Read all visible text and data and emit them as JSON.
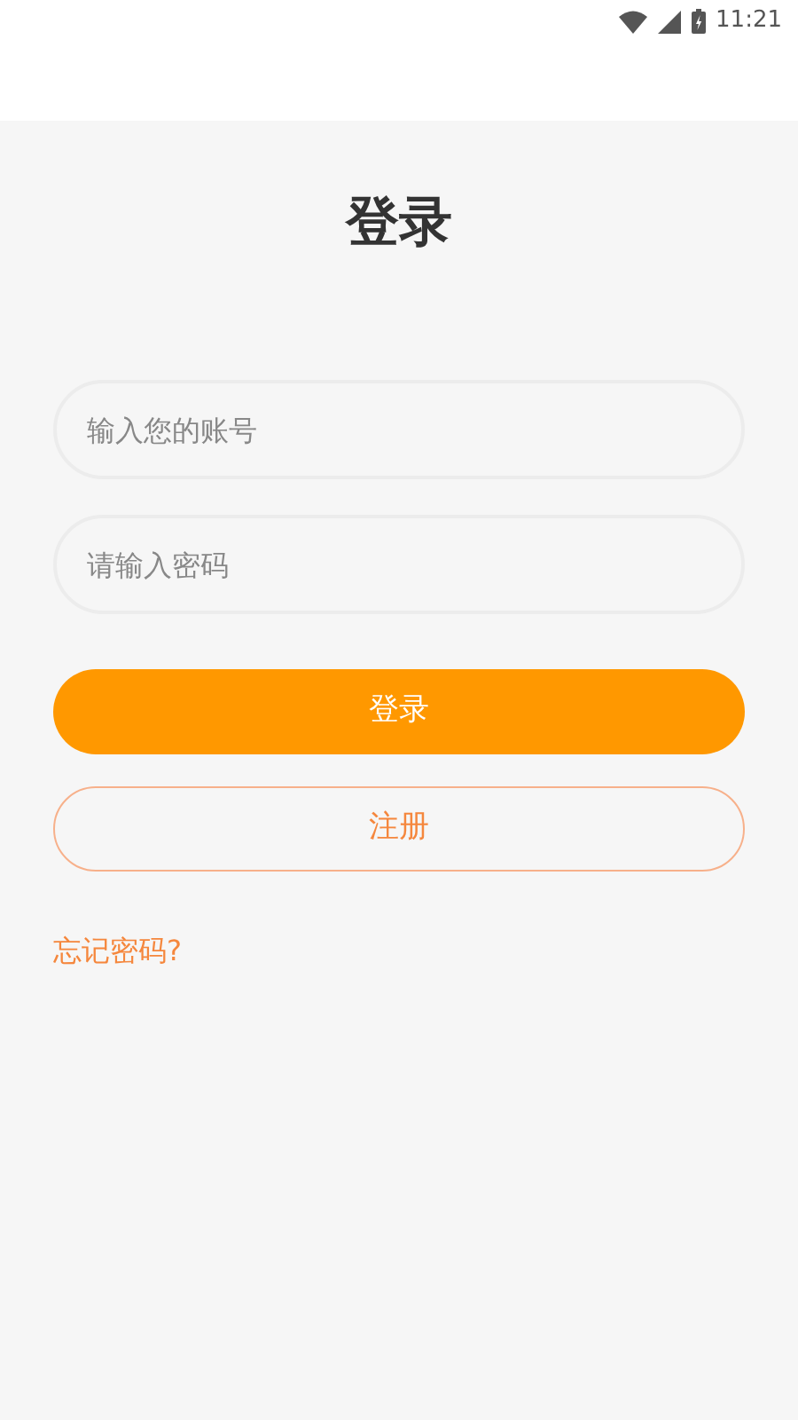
{
  "status_bar": {
    "time": "11:21"
  },
  "title": "登录",
  "fields": [
    {
      "placeholder": "输入您的账号"
    },
    {
      "placeholder": "请输入密码"
    }
  ],
  "login_button": "登录",
  "register_button": "注册",
  "forgot_link": "忘记密码?"
}
